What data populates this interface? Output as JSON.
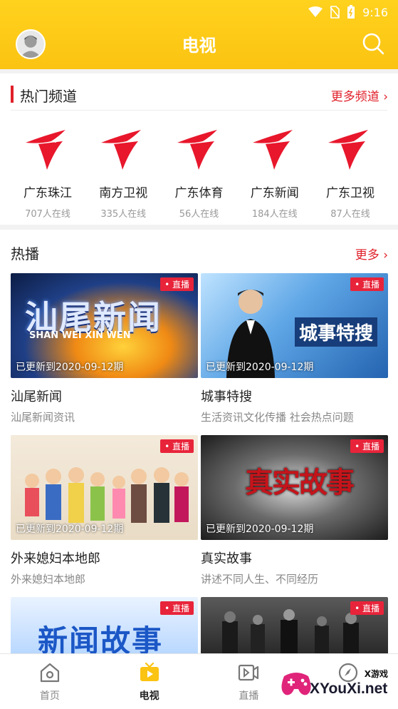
{
  "status": {
    "time": "9:16"
  },
  "header": {
    "title": "电视"
  },
  "hot_channels": {
    "title": "热门频道",
    "more": "更多频道 ›",
    "items": [
      {
        "name": "广东珠江",
        "count": "707人在线"
      },
      {
        "name": "南方卫视",
        "count": "335人在线"
      },
      {
        "name": "广东体育",
        "count": "56人在线"
      },
      {
        "name": "广东新闻",
        "count": "184人在线"
      },
      {
        "name": "广东卫视",
        "count": "87人在线"
      }
    ]
  },
  "hot_play": {
    "title": "热播",
    "more": "更多 ›",
    "items": [
      {
        "badge": "• 直播",
        "updated": "已更新到2020-09-12期",
        "title": "汕尾新闻",
        "subtitle": "汕尾新闻资讯",
        "thumb_text": "汕尾新闻",
        "thumb_sub": "SHAN WEI XIN WEN"
      },
      {
        "badge": "• 直播",
        "updated": "已更新到2020-09-12期",
        "title": "城事特搜",
        "subtitle": "生活资讯文化传播 社会热点问题",
        "thumb_text": "城事特搜"
      },
      {
        "badge": "• 直播",
        "updated": "已更新到2020-09-12期",
        "title": "外来媳妇本地郎",
        "subtitle": "外来媳妇本地郎",
        "thumb_text": ""
      },
      {
        "badge": "• 直播",
        "updated": "已更新到2020-09-12期",
        "title": "真实故事",
        "subtitle": "讲述不同人生、不同经历",
        "thumb_text": "真实故事"
      },
      {
        "badge": "• 直播",
        "thumb_text": "新闻故事"
      },
      {
        "badge": "• 直播"
      }
    ]
  },
  "tabbar": {
    "items": [
      {
        "label": "首页",
        "icon": "home-icon"
      },
      {
        "label": "电视",
        "icon": "tv-icon"
      },
      {
        "label": "直播",
        "icon": "live-icon"
      },
      {
        "label": "",
        "icon": "compass-icon"
      }
    ]
  },
  "watermark": {
    "main": "XYouXi.net",
    "corner": "X游戏"
  },
  "colors": {
    "accent": "#e0202a",
    "header": "#fbc312",
    "badge": "#e8243a"
  }
}
